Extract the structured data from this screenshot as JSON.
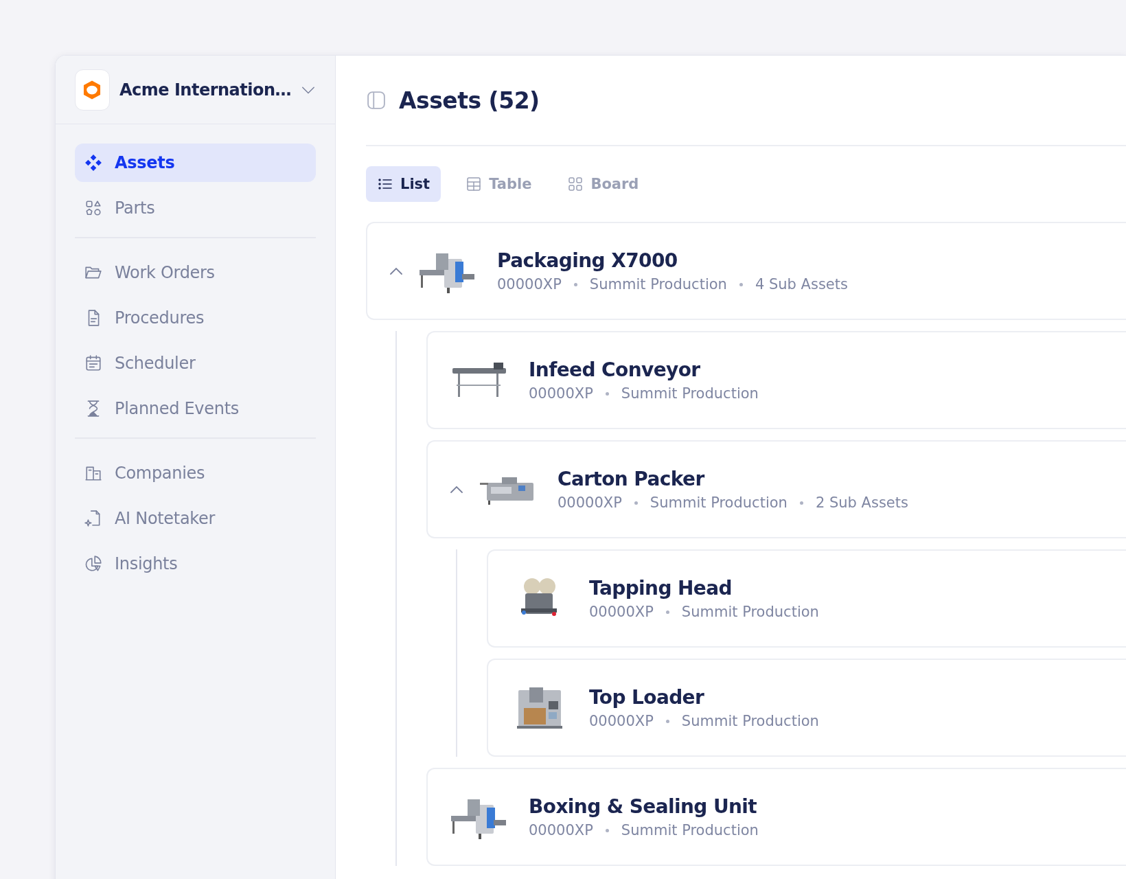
{
  "sidebar": {
    "workspace": "Acme Internation…",
    "sections": [
      {
        "items": [
          {
            "label": "Assets",
            "kind": "diamonds",
            "selected": true
          },
          {
            "label": "Parts",
            "kind": "shapes",
            "selected": false
          }
        ]
      },
      {
        "items": [
          {
            "label": "Work Orders",
            "kind": "folder",
            "selected": false
          },
          {
            "label": "Procedures",
            "kind": "document",
            "selected": false
          },
          {
            "label": "Scheduler",
            "kind": "calendar",
            "selected": false
          },
          {
            "label": "Planned Events",
            "kind": "hourglass",
            "selected": false
          }
        ]
      },
      {
        "items": [
          {
            "label": "Companies",
            "kind": "building",
            "selected": false
          },
          {
            "label": "AI Notetaker",
            "kind": "sparkle-file",
            "selected": false
          },
          {
            "label": "Insights",
            "kind": "pie",
            "selected": false
          }
        ]
      }
    ]
  },
  "header": {
    "title": "Assets (52)"
  },
  "views": [
    {
      "label": "List",
      "kind": "list",
      "selected": true
    },
    {
      "label": "Table",
      "kind": "table",
      "selected": false
    },
    {
      "label": "Board",
      "kind": "board",
      "selected": false
    }
  ],
  "assets": [
    {
      "name": "Packaging X7000",
      "code": "00000XP",
      "location": "Summit Production",
      "sub_assets": "4 Sub Assets",
      "expanded": true,
      "children": [
        {
          "name": "Infeed Conveyor",
          "code": "00000XP",
          "location": "Summit Production"
        },
        {
          "name": "Carton Packer",
          "code": "00000XP",
          "location": "Summit Production",
          "sub_assets": "2 Sub Assets",
          "expanded": true,
          "children": [
            {
              "name": "Tapping Head",
              "code": "00000XP",
              "location": "Summit Production"
            },
            {
              "name": "Top Loader",
              "code": "00000XP",
              "location": "Summit Production"
            }
          ]
        },
        {
          "name": "Boxing & Sealing Unit",
          "code": "00000XP",
          "location": "Summit Production"
        }
      ]
    }
  ]
}
